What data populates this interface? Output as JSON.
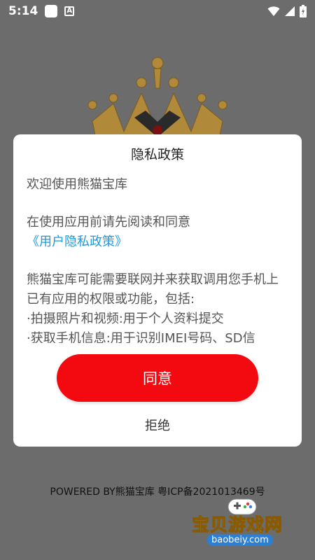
{
  "status_bar": {
    "time": "5:14",
    "notification_letter": "A"
  },
  "dialog": {
    "title": "隐私政策",
    "welcome": "欢迎使用熊猫宝库",
    "intro_prefix": "在使用应用前请先阅读和同意",
    "intro_link": "《用户隐私政策》",
    "paragraph": "熊猫宝库可能需要联网并来获取调用您手机上已有应用的权限或功能，包括:",
    "bullet_1": "·拍摄照片和视频:用于个人资料提交",
    "bullet_2": "·获取手机信息:用于识别IMEI号码、SD信",
    "agree_label": "同意",
    "reject_label": "拒绝"
  },
  "footer": {
    "text": "POWERED BY熊猫宝库   粤ICP备2021013469号"
  },
  "watermark": {
    "title": "宝贝游戏网",
    "url": "baobeiy.com"
  },
  "colors": {
    "overlay_background": "#6c6c6c",
    "agree_button": "#f20a10",
    "link": "#1a9be6"
  }
}
